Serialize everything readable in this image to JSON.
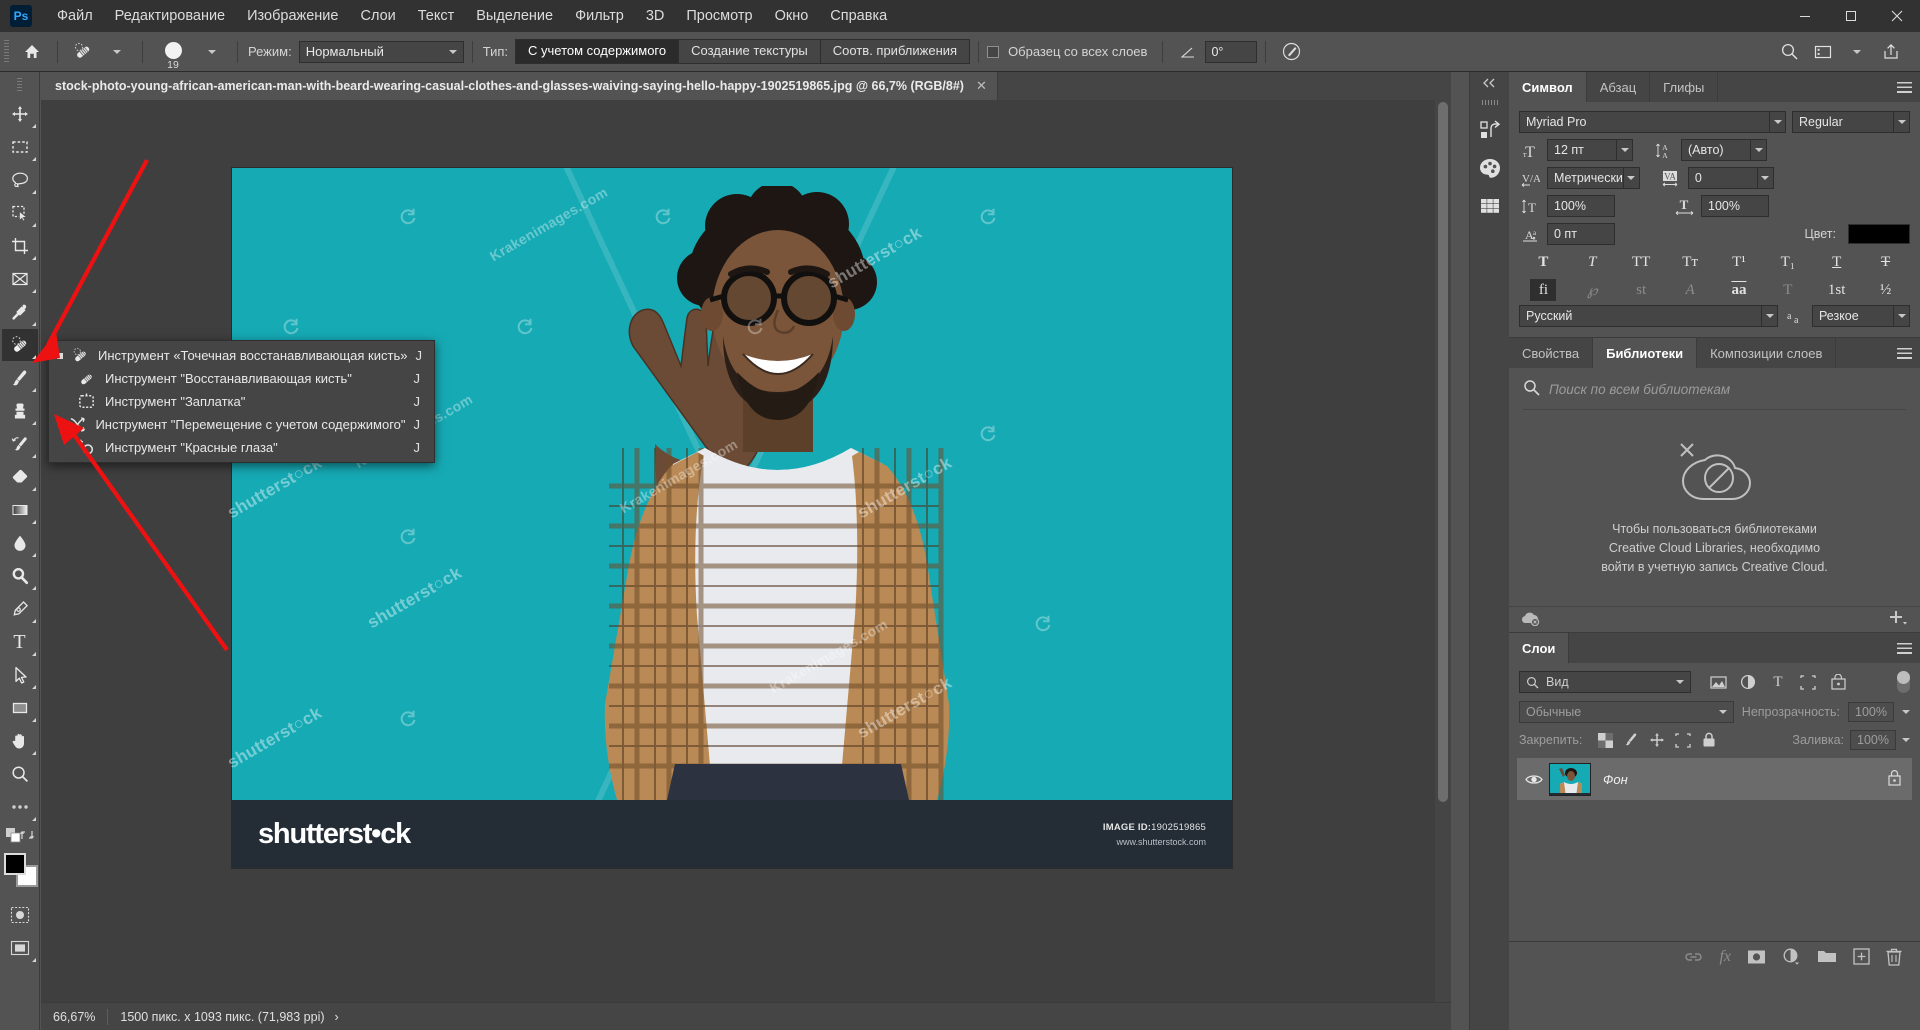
{
  "app": {
    "logo": "Ps",
    "title": "Adobe Photoshop"
  },
  "menubar": {
    "items": [
      {
        "label": "Файл"
      },
      {
        "label": "Редактирование"
      },
      {
        "label": "Изображение"
      },
      {
        "label": "Слои"
      },
      {
        "label": "Текст"
      },
      {
        "label": "Выделение"
      },
      {
        "label": "Фильтр"
      },
      {
        "label": "3D"
      },
      {
        "label": "Просмотр"
      },
      {
        "label": "Окно"
      },
      {
        "label": "Справка"
      }
    ],
    "window_controls": {
      "minimize": "—",
      "maximize": "▢",
      "close": "✕"
    }
  },
  "options_bar": {
    "home_icon": "home-icon",
    "tool_icon": "spot-healing-brush-icon",
    "brush_size": "19",
    "mode_label": "Режим:",
    "mode_value": "Нормальный",
    "type_label": "Тип:",
    "type_options": [
      "С учетом содержимого",
      "Создание текстуры",
      "Соотв. приближения"
    ],
    "type_selected": "С учетом содержимого",
    "sample_all_layers": "Образец со всех слоев",
    "angle_value": "0°",
    "pressure_icon": "pressure-icon",
    "right_icons": [
      "search-icon",
      "workspace-icon",
      "chevron-down-icon",
      "share-icon"
    ]
  },
  "toolbar": {
    "tools": [
      {
        "name": "move-tool",
        "icon": "move"
      },
      {
        "name": "rectangular-marquee-tool",
        "icon": "marquee"
      },
      {
        "name": "lasso-tool",
        "icon": "lasso"
      },
      {
        "name": "object-selection-tool",
        "icon": "quickselect"
      },
      {
        "name": "crop-tool",
        "icon": "crop"
      },
      {
        "name": "frame-tool",
        "icon": "frame"
      },
      {
        "name": "eyedropper-tool",
        "icon": "eyedropper"
      },
      {
        "name": "spot-healing-brush-tool",
        "icon": "healing",
        "selected": true
      },
      {
        "name": "brush-tool",
        "icon": "brush"
      },
      {
        "name": "clone-stamp-tool",
        "icon": "stamp"
      },
      {
        "name": "history-brush-tool",
        "icon": "historybrush"
      },
      {
        "name": "eraser-tool",
        "icon": "eraser"
      },
      {
        "name": "gradient-tool",
        "icon": "gradient"
      },
      {
        "name": "blur-tool",
        "icon": "blur"
      },
      {
        "name": "dodge-tool",
        "icon": "dodge"
      },
      {
        "name": "pen-tool",
        "icon": "pen"
      },
      {
        "name": "type-tool",
        "icon": "type"
      },
      {
        "name": "path-selection-tool",
        "icon": "pathselect"
      },
      {
        "name": "rectangle-tool",
        "icon": "rectangle"
      },
      {
        "name": "hand-tool",
        "icon": "hand"
      },
      {
        "name": "zoom-tool",
        "icon": "zoom"
      },
      {
        "name": "edit-toolbar-tool",
        "icon": "ellipsis"
      }
    ],
    "foreground_color": "#000000",
    "background_color": "#ffffff"
  },
  "flyout_menu": {
    "items": [
      {
        "label": "Инструмент «Точечная восстанавливающая кисть»",
        "shortcut": "J",
        "icon": "spot-healing-icon",
        "selected": true
      },
      {
        "label": "Инструмент \"Восстанавливающая кисть\"",
        "shortcut": "J",
        "icon": "healing-brush-icon",
        "selected": false
      },
      {
        "label": "Инструмент \"Заплатка\"",
        "shortcut": "J",
        "icon": "patch-icon",
        "selected": false
      },
      {
        "label": "Инструмент \"Перемещение с учетом содержимого\"",
        "shortcut": "J",
        "icon": "content-aware-move-icon",
        "selected": false
      },
      {
        "label": "Инструмент \"Красные глаза\"",
        "shortcut": "J",
        "icon": "red-eye-icon",
        "selected": false
      }
    ]
  },
  "document": {
    "tab_title": "stock-photo-young-african-american-man-with-beard-wearing-casual-clothes-and-glasses-waiving-saying-hello-happy-1902519865.jpg @ 66,7% (RGB/8#)",
    "close_label": "✕",
    "zoom": "66,67%",
    "status": "1500 пикс. x 1093 пикс. (71,983 ppi)",
    "status_arrow": "›"
  },
  "canvas": {
    "bg_color": "#16aab5",
    "footer_bg": "#242c35",
    "shutterstock_logo": "shutterst•ck",
    "image_id_label": "IMAGE ID:",
    "image_id": "1902519865",
    "url": "www.shutterstock.com",
    "watermarks": [
      "shutterstock",
      "Krakenimages.com"
    ]
  },
  "right_rail": {
    "collapse_icon": "chevrons-left-icon",
    "icons": [
      "history-icon",
      "color-palette-icon",
      "swatches-grid-icon"
    ]
  },
  "character_panel": {
    "tabs": [
      {
        "label": "Символ",
        "active": true
      },
      {
        "label": "Абзац",
        "active": false
      },
      {
        "label": "Глифы",
        "active": false
      }
    ],
    "font_family": "Myriad Pro",
    "font_style": "Regular",
    "size_icon": "font-size-icon",
    "size": "12 пт",
    "leading_icon": "leading-icon",
    "leading": "(Авто)",
    "kerning_icon": "kerning-icon",
    "kerning": "Метрически",
    "tracking_icon": "tracking-icon",
    "tracking": "0",
    "vscale_icon": "vertical-scale-icon",
    "vertical_scale": "100%",
    "hscale_icon": "horizontal-scale-icon",
    "horizontal_scale": "100%",
    "baseline_icon": "baseline-shift-icon",
    "baseline_shift": "0 пт",
    "color_label": "Цвет:",
    "color_value": "#000000",
    "style_buttons": [
      "T",
      "T",
      "TT",
      "Tт",
      "T¹",
      "T₁",
      "T",
      "T"
    ],
    "ot_buttons": [
      "fi",
      "℘",
      "st",
      "A",
      "aa",
      "T",
      "1st",
      "½"
    ],
    "language": "Русский",
    "antialias_icon": "anti-alias-icon",
    "antialias": "Резкое"
  },
  "libraries_panel": {
    "tabs": [
      {
        "label": "Свойства",
        "active": false
      },
      {
        "label": "Библиотеки",
        "active": true
      },
      {
        "label": "Композиции слоев",
        "active": false
      }
    ],
    "search_placeholder": "Поиск по всем библиотекам",
    "empty_icon": "creative-cloud-offline-icon",
    "empty_message_lines": [
      "Чтобы пользоваться библиотеками",
      "Creative Cloud Libraries, необходимо",
      "войти в учетную запись Creative Cloud."
    ],
    "footer_left_icon": "cloud-offline-icon",
    "footer_right_icon": "add-icon"
  },
  "layers_panel": {
    "tabs": [
      {
        "label": "Слои",
        "active": true
      }
    ],
    "filter_label": "Вид",
    "filter_icons": [
      "pixel-filter-icon",
      "adjustment-filter-icon",
      "type-filter-icon",
      "shape-filter-icon",
      "smart-object-filter-icon"
    ],
    "blend_mode": "Обычные",
    "opacity_label": "Непрозрачность:",
    "opacity_value": "100%",
    "lock_label": "Закрепить:",
    "lock_icons": [
      "lock-transparency-icon",
      "lock-image-icon",
      "lock-position-icon",
      "lock-artboard-icon",
      "lock-all-icon"
    ],
    "fill_label": "Заливка:",
    "fill_value": "100%",
    "layers": [
      {
        "name": "Фон",
        "visible": true,
        "locked": true,
        "thumbnail": "background-thumbnail"
      }
    ],
    "bottom_icons": [
      "link-layers-icon",
      "fx-icon",
      "layer-mask-icon",
      "adjustment-layer-icon",
      "new-group-icon",
      "new-layer-icon",
      "delete-layer-icon"
    ]
  }
}
